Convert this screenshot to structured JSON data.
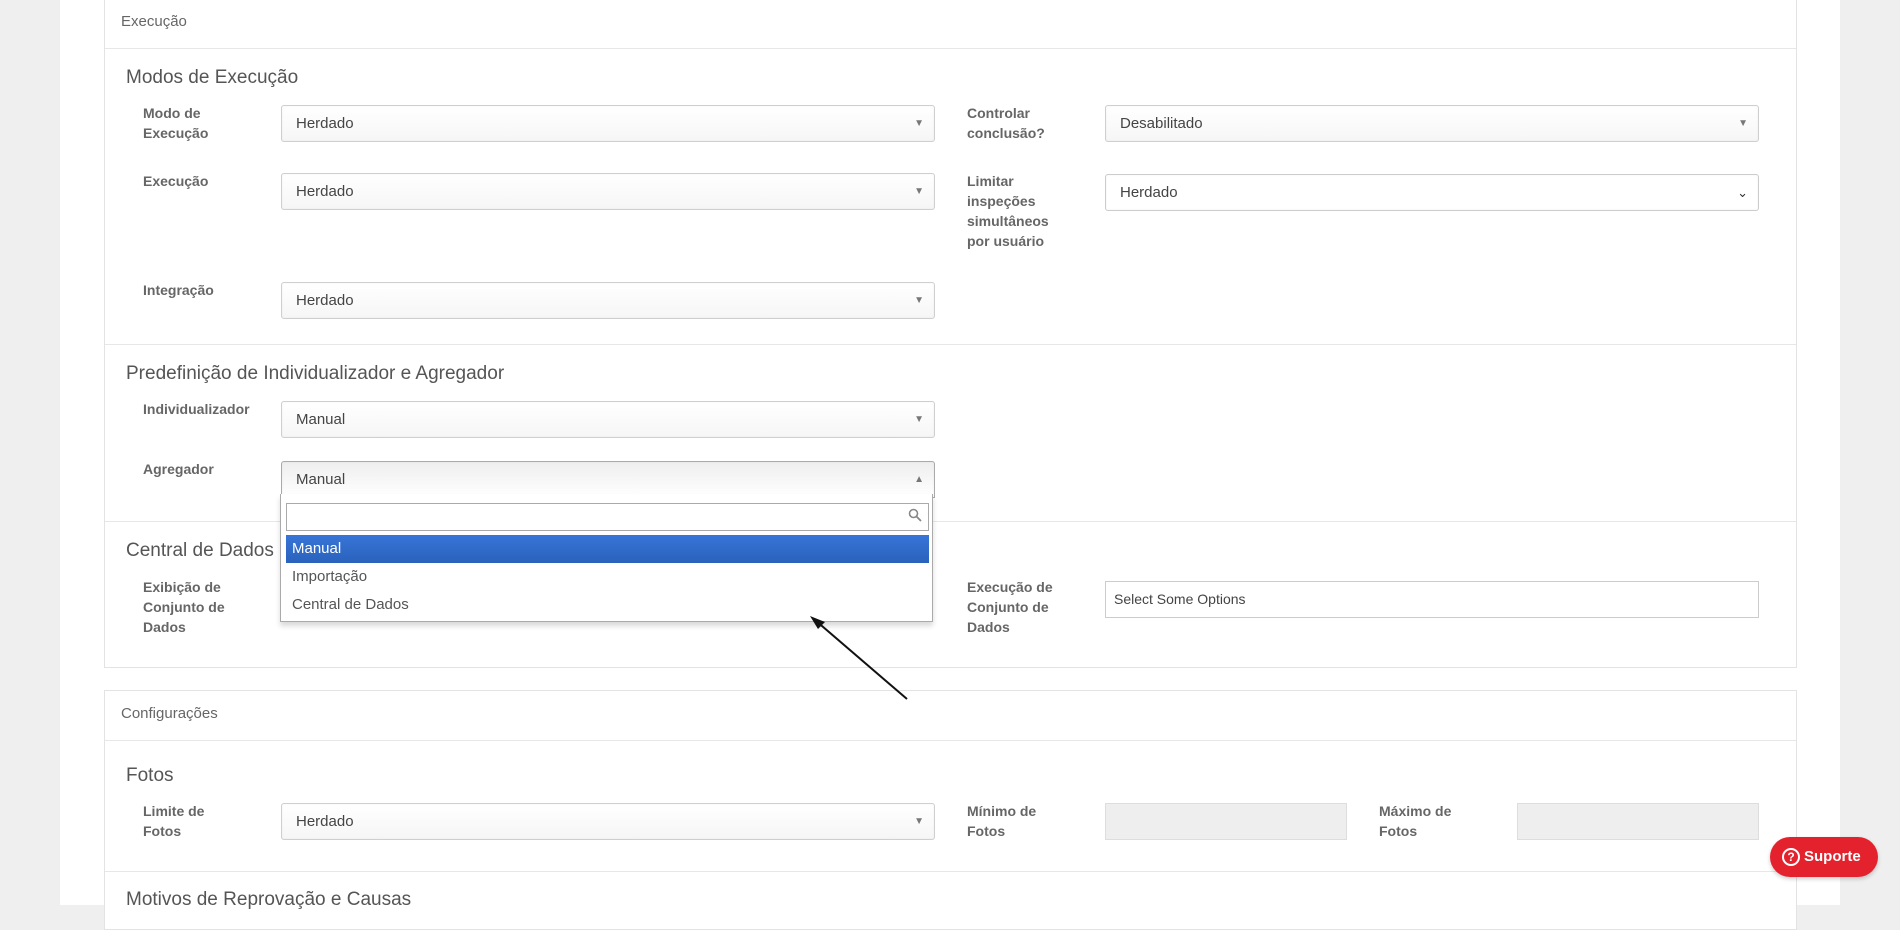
{
  "execucao_panel": {
    "header": "Execução",
    "modos": {
      "title": "Modos de Execução",
      "modo_label": "Modo de Execução",
      "modo_value": "Herdado",
      "controlar_label": "Controlar conclusão?",
      "controlar_value": "Desabilitado",
      "execucao_label": "Execução",
      "execucao_value": "Herdado",
      "limitar_label": "Limitar inspeções simultâneos por usuário",
      "limitar_value": "Herdado",
      "integracao_label": "Integração",
      "integracao_value": "Herdado"
    },
    "predef": {
      "title": "Predefinição de Individualizador e Agregador",
      "individualizador_label": "Individualizador",
      "individualizador_value": "Manual",
      "agregador_label": "Agregador",
      "agregador_value": "Manual"
    },
    "central": {
      "title": "Central de Dados",
      "exibicao_label": "Exibição de Conjunto de Dados",
      "execucao_conj_label": "Execução de Conjunto de Dados",
      "execucao_conj_placeholder": "Select Some Options"
    }
  },
  "dropdown": {
    "search_value": "",
    "options": [
      "Manual",
      "Importação",
      "Central de Dados"
    ],
    "selected": "Manual"
  },
  "configuracoes_panel": {
    "header": "Configurações",
    "fotos": {
      "title": "Fotos",
      "limite_label": "Limite de Fotos",
      "limite_value": "Herdado",
      "minimo_label": "Mínimo de Fotos",
      "maximo_label": "Máximo de Fotos"
    },
    "motivos_title": "Motivos de Reprovação e Causas"
  },
  "support_button": {
    "label": "Suporte"
  },
  "icons": {
    "search": "magnifier-icon",
    "dropdown": "triangle-down-icon",
    "support": "help-circle-icon"
  }
}
